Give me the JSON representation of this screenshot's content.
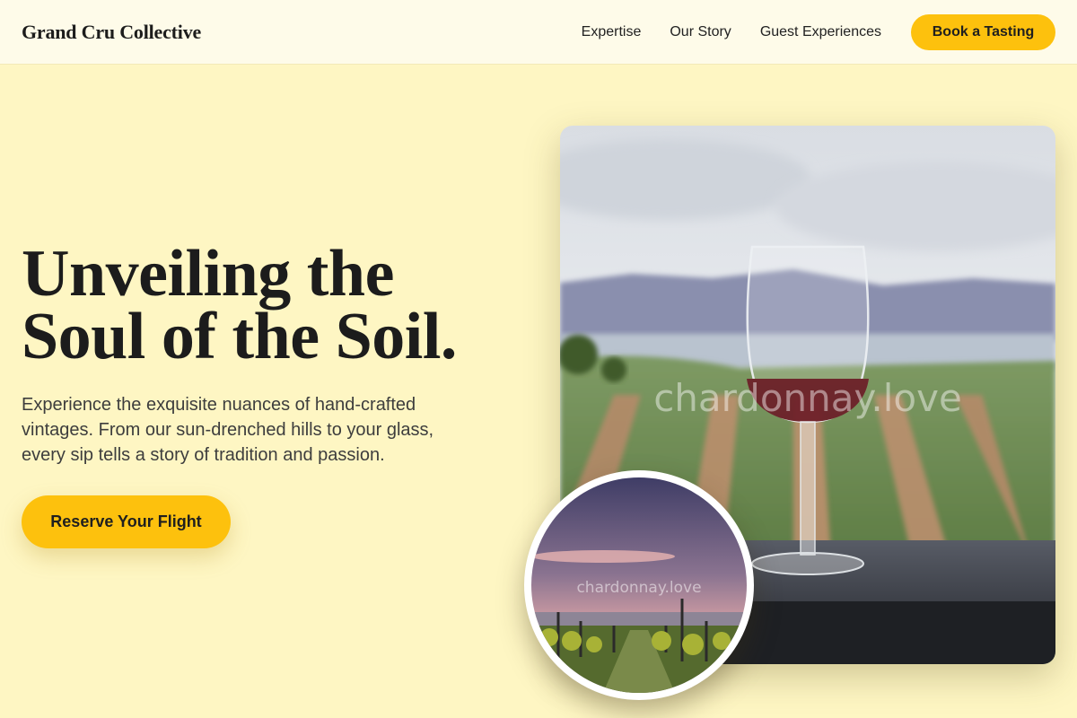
{
  "header": {
    "brand": "Grand Cru Collective",
    "nav": [
      "Expertise",
      "Our Story",
      "Guest Experiences"
    ],
    "cta": "Book a Tasting"
  },
  "hero": {
    "title_lines": [
      "Unveiling the",
      "Soul of the Soil."
    ],
    "subtitle_lines": [
      "Experience the exquisite nuances of hand-crafted",
      "vintages. From our sun-drenched hills to your glass,",
      "every sip tells a story of tradition and passion."
    ],
    "cta": "Reserve Your Flight"
  },
  "images": {
    "main_watermark": "chardonnay.love",
    "circle_watermark": "chardonnay.love"
  },
  "colors": {
    "background": "#fef6c3",
    "header_bg": "#fefbe9",
    "accent": "#fdc10d"
  }
}
